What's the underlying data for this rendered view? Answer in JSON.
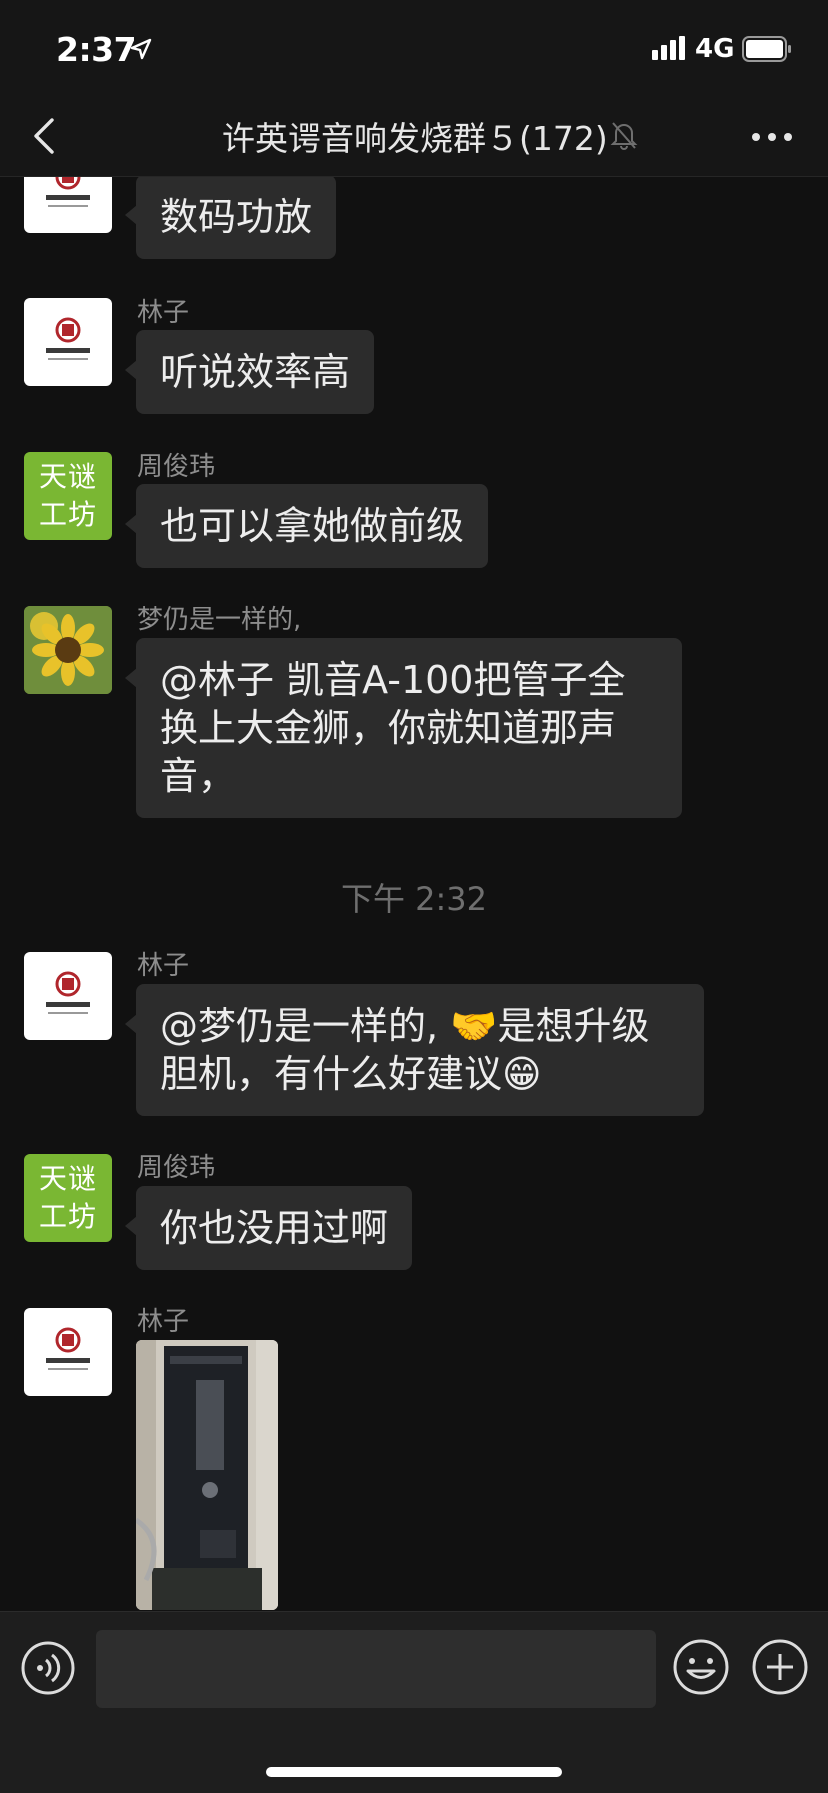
{
  "status_bar": {
    "time": "2:37",
    "network": "4G"
  },
  "nav": {
    "title": "许英谔音响发烧群５(172)"
  },
  "messages": [
    {
      "sender": "",
      "text": "数码功放",
      "avatar": "logo-avatar"
    },
    {
      "sender": "林子",
      "text": "听说效率高",
      "avatar": "logo-avatar"
    },
    {
      "sender": "周俊玮",
      "text": "也可以拿她做前级",
      "avatar": "green-avatar",
      "avatar_text": "天谜\n工坊"
    },
    {
      "sender": "梦仍是一样的,",
      "text": "@林子 凯音A-100把管子全换上大金狮，你就知道那声音，",
      "avatar": "sunflower-avatar"
    },
    {
      "sender": "林子",
      "text": "@梦仍是一样的, 🤝是想升级胆机，有什么好建议😁",
      "avatar": "logo-avatar"
    },
    {
      "sender": "周俊玮",
      "text": "你也没用过啊",
      "avatar": "green-avatar",
      "avatar_text": "天谜\n工坊"
    },
    {
      "sender": "林子",
      "text": "",
      "avatar": "logo-avatar",
      "image": "amplifier-photo"
    }
  ],
  "time_separator": "下午 2:32",
  "input": {
    "placeholder": ""
  },
  "colors": {
    "background": "#111111",
    "bubble": "#2c2c2c",
    "green_avatar": "#7ab733",
    "logo_red": "#b0262c"
  }
}
